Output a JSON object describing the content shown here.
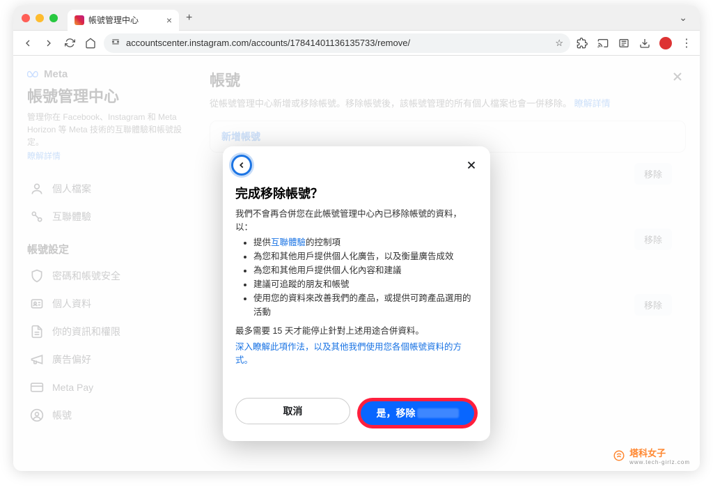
{
  "browser": {
    "tab_title": "帳號管理中心",
    "url": "accountscenter.instagram.com/accounts/17841401136135733/remove/"
  },
  "sidebar": {
    "brand": "Meta",
    "title": "帳號管理中心",
    "desc": "管理你在 Facebook、Instagram 和 Meta Horizon 等 Meta 技術的互聯體驗和帳號設定。",
    "learn_more": "瞭解詳情",
    "items": [
      {
        "label": "個人檔案"
      },
      {
        "label": "互聯體驗"
      }
    ],
    "section_heading": "帳號設定",
    "settings_items": [
      {
        "label": "密碼和帳號安全"
      },
      {
        "label": "個人資料"
      },
      {
        "label": "你的資訊和權限"
      },
      {
        "label": "廣告偏好"
      },
      {
        "label": "Meta Pay"
      },
      {
        "label": "帳號"
      }
    ]
  },
  "main": {
    "title": "帳號",
    "desc_prefix": "從帳號管理中心新增或移除帳號。移除帳號後，該帳號管理的所有個人檔案也會一併移除。",
    "desc_link": "瞭解詳情",
    "add_label": "新增帳號",
    "remove_label": "移除"
  },
  "modal": {
    "title": "完成移除帳號？",
    "intro": "我們不會再合併您在此帳號管理中心內已移除帳號的資料，以：",
    "bullets": [
      {
        "prefix": "提供",
        "link": "互聯體驗",
        "suffix": "的控制項"
      },
      {
        "text": "為您和其他用戶提供個人化廣告，以及衡量廣告成效"
      },
      {
        "text": "為您和其他用戶提供個人化內容和建議"
      },
      {
        "text": "建議可追蹤的朋友和帳號"
      },
      {
        "text": "使用您的資料來改善我們的產品，或提供可跨產品選用的活動"
      }
    ],
    "note": "最多需要 15 天才能停止針對上述用途合併資料。",
    "deep_link": "深入瞭解此項作法，以及其他我們使用您各個帳號資料的方式。",
    "cancel": "取消",
    "confirm": "是，移除"
  },
  "watermark": {
    "text": "塔科女子",
    "url": "www.tech-girlz.com"
  }
}
